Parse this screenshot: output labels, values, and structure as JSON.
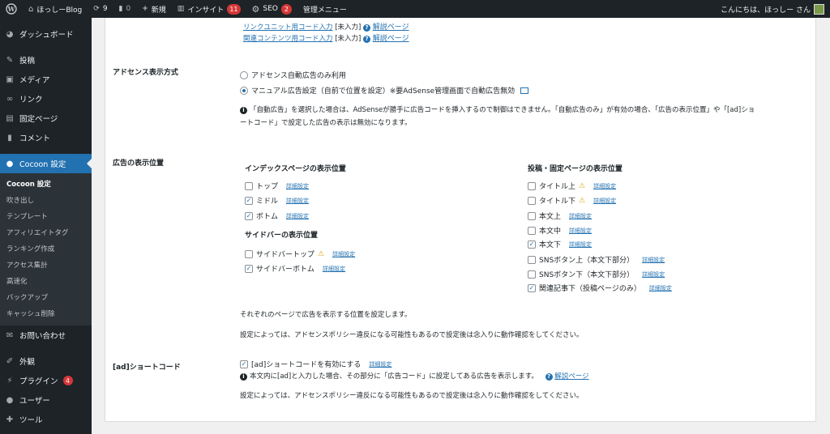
{
  "adminbar": {
    "site_name": "ほっしーBlog",
    "updates_count": "9",
    "comments_count": "0",
    "new_label": "新規",
    "insight_label": "インサイト",
    "insight_badge": "11",
    "seo_label": "SEO",
    "seo_badge": "2",
    "manage_menu": "管理メニュー",
    "greeting": "こんにちは、ほっしー さん"
  },
  "sidebar": {
    "items_top": [
      {
        "label": "ダッシュボード",
        "icon": "dashboard-icon"
      },
      {
        "label": "投稿",
        "icon": "pin-icon"
      },
      {
        "label": "メディア",
        "icon": "media-icon"
      },
      {
        "label": "リンク",
        "icon": "link-icon"
      },
      {
        "label": "固定ページ",
        "icon": "page-icon"
      },
      {
        "label": "コメント",
        "icon": "comment-icon"
      }
    ],
    "current": {
      "label": "Cocoon 設定",
      "icon": "cocoon-icon"
    },
    "submenu": [
      "Cocoon 設定",
      "吹き出し",
      "テンプレート",
      "アフィリエイトタグ",
      "ランキング作成",
      "アクセス集計",
      "高速化",
      "バックアップ",
      "キャッシュ削除"
    ],
    "items_bottom": [
      {
        "label": "お問い合わせ",
        "icon": "mail-icon"
      },
      {
        "label": "外観",
        "icon": "brush-icon"
      },
      {
        "label": "プラグイン",
        "icon": "plugin-icon",
        "badge": "4"
      },
      {
        "label": "ユーザー",
        "icon": "user-icon"
      },
      {
        "label": "ツール",
        "icon": "wrench-icon"
      }
    ]
  },
  "top_links": [
    {
      "label": "リンクユニット用コード入力",
      "status": "[未入力]",
      "help": "解説ページ"
    },
    {
      "label": "関連コンテンツ用コード入力",
      "status": "[未入力]",
      "help": "解説ページ"
    }
  ],
  "ad_mode": {
    "label": "アドセンス表示方式",
    "option1": "アドセンス自動広告のみ利用",
    "option2": "マニュアル広告設定（自前で位置を設定）※要AdSense管理画面で自動広告無効",
    "note_line1": "「自動広告」を選択した場合は、AdSenseが勝手に広告コードを挿入するので制御はできません。「自動広告のみ」が有効の場合、「広告の表示位置」や「[ad]ショ",
    "note_line2": "ートコード」で設定した広告の表示は無効になります。"
  },
  "positions": {
    "label": "広告の表示位置",
    "detail": "詳細設定",
    "index_title": "インデックスページの表示位置",
    "index_items": [
      {
        "label": "トップ",
        "checked": false
      },
      {
        "label": "ミドル",
        "checked": true
      },
      {
        "label": "ボトム",
        "checked": true
      }
    ],
    "sidebar_title": "サイドバーの表示位置",
    "sidebar_items": [
      {
        "label": "サイドバートップ",
        "checked": false,
        "warn": true
      },
      {
        "label": "サイドバーボトム",
        "checked": true
      }
    ],
    "post_title": "投稿・固定ページの表示位置",
    "post_items": [
      {
        "label": "タイトル上",
        "checked": false,
        "warn": true
      },
      {
        "label": "タイトル下",
        "checked": false,
        "warn": true
      },
      {
        "label": "本文上",
        "checked": false
      },
      {
        "label": "本文中",
        "checked": false
      },
      {
        "label": "本文下",
        "checked": true
      },
      {
        "label": "SNSボタン上（本文下部分）",
        "checked": false
      },
      {
        "label": "SNSボタン下（本文下部分）",
        "checked": false
      },
      {
        "label": "関連記事下（投稿ページのみ）",
        "checked": true
      }
    ],
    "desc1": "それぞれのページで広告を表示する位置を設定します。",
    "desc2": "設定によっては、アドセンスポリシー違反になる可能性もあるので設定後は念入りに動作確認をしてください。"
  },
  "shortcode": {
    "label": "[ad]ショートコード",
    "checkbox": "[ad]ショートコードを有効にする",
    "detail": "詳細設定",
    "info": "本文内に[ad]と入力した場合、その部分に「広告コード」に設定してある広告を表示します。",
    "help": "解説ページ",
    "desc": "設定によっては、アドセンスポリシー違反になる可能性もあるので設定後は念入りに動作確認をしてください。"
  },
  "colors": {
    "accent": "#2271b1",
    "adminbar": "#1d2327",
    "badge": "#d63638",
    "warn": "#dba617"
  }
}
